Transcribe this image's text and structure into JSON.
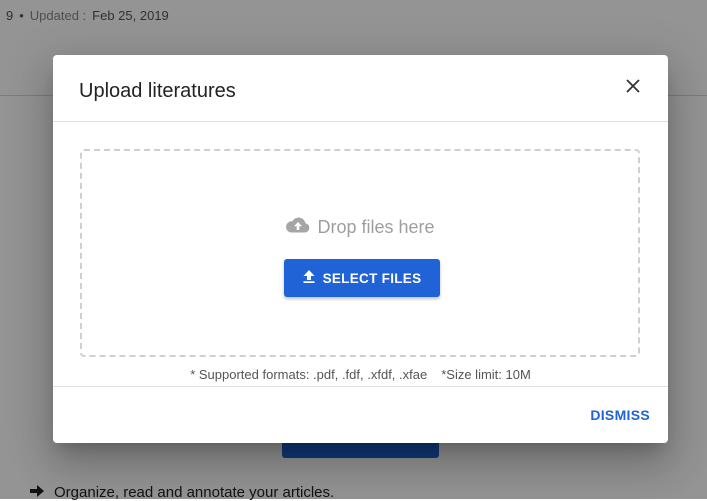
{
  "background": {
    "meta_prefix": "9",
    "meta_separator": "•",
    "updated_label": "Updated :",
    "updated_date": "Feb 25, 2019",
    "bullet_text": "Organize, read and annotate your articles."
  },
  "dialog": {
    "title": "Upload literatures",
    "close_icon": "close-icon",
    "dropzone": {
      "hint": "Drop files here",
      "hint_icon": "cloud-upload-icon",
      "select_button": "SELECT FILES",
      "select_icon": "upload-arrow-icon"
    },
    "formats_note": "* Supported formats: .pdf, .fdf, .xfdf, .xfae",
    "size_note": "*Size limit: 10M",
    "dismiss_button": "DISMISS"
  },
  "colors": {
    "primary": "#1f63d6",
    "overlay": "rgba(0,0,0,0.42)",
    "muted_text": "#9e9e9e"
  }
}
